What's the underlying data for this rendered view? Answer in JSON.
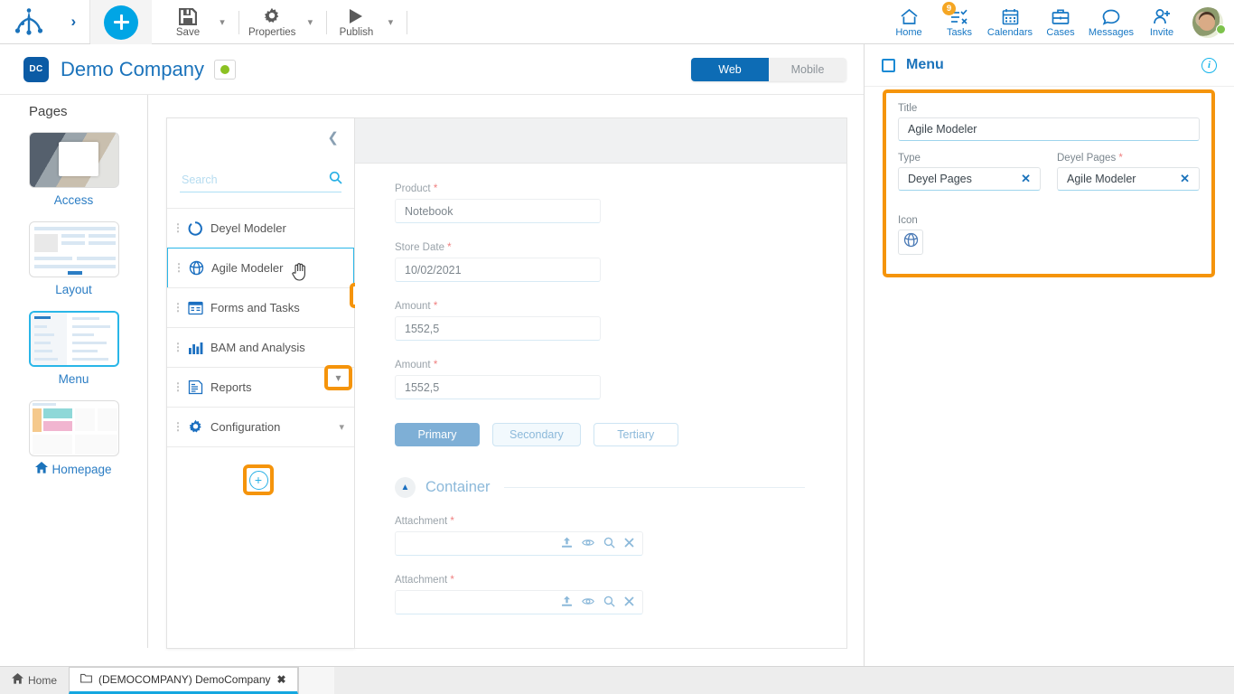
{
  "toolbar": {
    "logo_icon": "deyel-logo",
    "expand_icon": "chevron-right-icon",
    "add_label": "+",
    "items": [
      {
        "label": "Save",
        "icon": "save-icon",
        "has_caret": true
      },
      {
        "label": "Properties",
        "icon": "gear-icon",
        "has_caret": true
      },
      {
        "label": "Publish",
        "icon": "play-icon",
        "has_caret": true
      }
    ],
    "nav": [
      {
        "label": "Home",
        "icon": "home-icon",
        "badge": ""
      },
      {
        "label": "Tasks",
        "icon": "tasks-icon",
        "badge": "9"
      },
      {
        "label": "Calendars",
        "icon": "calendar-icon",
        "badge": ""
      },
      {
        "label": "Cases",
        "icon": "briefcase-icon",
        "badge": ""
      },
      {
        "label": "Messages",
        "icon": "chat-bubble-icon",
        "badge": ""
      },
      {
        "label": "Invite",
        "icon": "user-add-icon",
        "badge": ""
      }
    ]
  },
  "company_header": {
    "badge": "DC",
    "name": "Demo Company",
    "status_color": "#8bc122",
    "segmented": {
      "web": "Web",
      "mobile": "Mobile",
      "active": "Web"
    }
  },
  "pages": {
    "title": "Pages",
    "items": [
      {
        "label": "Access",
        "selected": false,
        "thumb": "t-access"
      },
      {
        "label": "Layout",
        "selected": false,
        "thumb": "t-layout"
      },
      {
        "label": "Menu",
        "selected": true,
        "thumb": "t-menu"
      },
      {
        "label": "Homepage",
        "selected": false,
        "thumb": "t-home",
        "icon": "home-icon"
      }
    ]
  },
  "tree_panel": {
    "collapse_icon": "chevron-left-icon",
    "search": {
      "placeholder": "Search",
      "value": "",
      "icon": "search-icon"
    },
    "nodes": [
      {
        "label": "Deyel Modeler",
        "icon": "circle-outline-icon",
        "selected": false,
        "caret": ""
      },
      {
        "label": "Agile Modeler",
        "icon": "globe-icon",
        "selected": true,
        "caret": ""
      },
      {
        "label": "Forms and Tasks",
        "icon": "form-icon",
        "selected": false,
        "caret": ""
      },
      {
        "label": "BAM and Analysis",
        "icon": "bar-chart-icon",
        "selected": false,
        "caret": ""
      },
      {
        "label": "Reports",
        "icon": "report-icon",
        "selected": false,
        "caret": ""
      },
      {
        "label": "Configuration",
        "icon": "gear-icon",
        "selected": false,
        "caret": "chevron-down-icon"
      }
    ],
    "highlights": {
      "delete_icon": "trash-icon",
      "expand_icon": "chevron-down-icon",
      "add_icon": "plus-circle-icon"
    },
    "cursor": "hand-cursor"
  },
  "form": {
    "fields": [
      {
        "label": "Product",
        "required": true,
        "value": "Notebook"
      },
      {
        "label": "Store Date",
        "required": true,
        "value": "10/02/2021"
      },
      {
        "label": "Amount",
        "required": true,
        "value": "1552,5"
      },
      {
        "label": "Amount",
        "required": true,
        "value": "1552,5"
      }
    ],
    "buttons": [
      {
        "label": "Primary",
        "style": "primary"
      },
      {
        "label": "Secondary",
        "style": "secondary"
      },
      {
        "label": "Tertiary",
        "style": "tertiary"
      }
    ],
    "section": {
      "title": "Container",
      "toggle_icon": "chevron-up-icon"
    },
    "attachments": [
      {
        "label": "Attachment",
        "required": true,
        "value": ""
      },
      {
        "label": "Attachment",
        "required": true,
        "value": ""
      }
    ],
    "attachment_icons": [
      "upload-icon",
      "eye-icon",
      "search-icon",
      "close-icon"
    ]
  },
  "right_panel": {
    "title": "Menu",
    "checkbox_icon": "checkbox-icon",
    "info_icon": "info-icon",
    "title_field": {
      "label": "Title",
      "value": "Agile Modeler",
      "required": false
    },
    "type_field": {
      "label": "Type",
      "value": "Deyel Pages",
      "required": false,
      "clear_icon": "close-icon"
    },
    "pages_field": {
      "label": "Deyel Pages",
      "value": "Agile Modeler",
      "required": true,
      "clear_icon": "close-icon"
    },
    "icon_field": {
      "label": "Icon",
      "value": "globe-icon"
    }
  },
  "tabbar": {
    "home": {
      "label": "Home",
      "icon": "home-icon"
    },
    "tab": {
      "label": "(DEMOCOMPANY) DemoCompany",
      "icon": "folder-icon",
      "close": "✖"
    }
  },
  "colors": {
    "accent_blue": "#1b73bb",
    "cyan": "#29b0e5",
    "highlight_orange": "#f5940b",
    "online_green": "#8bc122",
    "badge_orange": "#f5a623"
  }
}
